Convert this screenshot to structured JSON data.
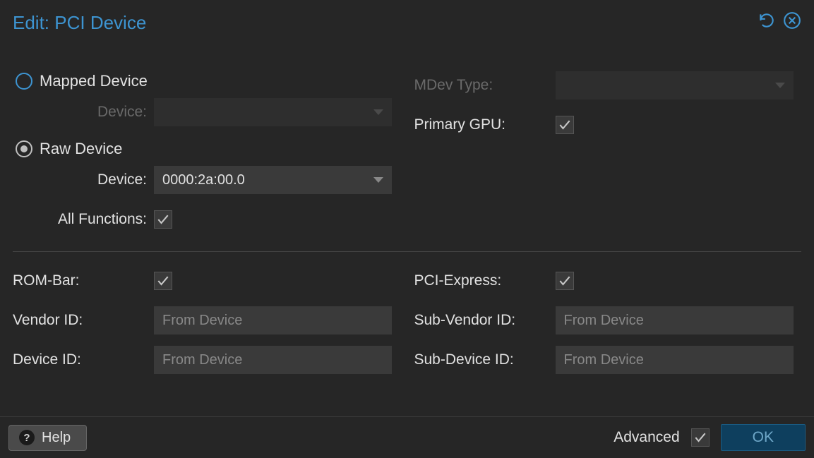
{
  "dialog": {
    "title": "Edit: PCI Device"
  },
  "deviceMode": {
    "mapped": {
      "label": "Mapped Device",
      "deviceLabel": "Device:",
      "deviceValue": ""
    },
    "raw": {
      "label": "Raw Device",
      "deviceLabel": "Device:",
      "deviceValue": "0000:2a:00.0",
      "allFunctionsLabel": "All Functions:"
    }
  },
  "rightTop": {
    "mdevTypeLabel": "MDev Type:",
    "mdevTypeValue": "",
    "primaryGpuLabel": "Primary GPU:"
  },
  "advanced": {
    "romBarLabel": "ROM-Bar:",
    "vendorIdLabel": "Vendor ID:",
    "vendorIdPlaceholder": "From Device",
    "deviceIdLabel": "Device ID:",
    "deviceIdPlaceholder": "From Device",
    "pciExpressLabel": "PCI-Express:",
    "subVendorIdLabel": "Sub-Vendor ID:",
    "subVendorIdPlaceholder": "From Device",
    "subDeviceIdLabel": "Sub-Device ID:",
    "subDeviceIdPlaceholder": "From Device"
  },
  "footer": {
    "helpLabel": "Help",
    "advancedLabel": "Advanced",
    "okLabel": "OK"
  }
}
